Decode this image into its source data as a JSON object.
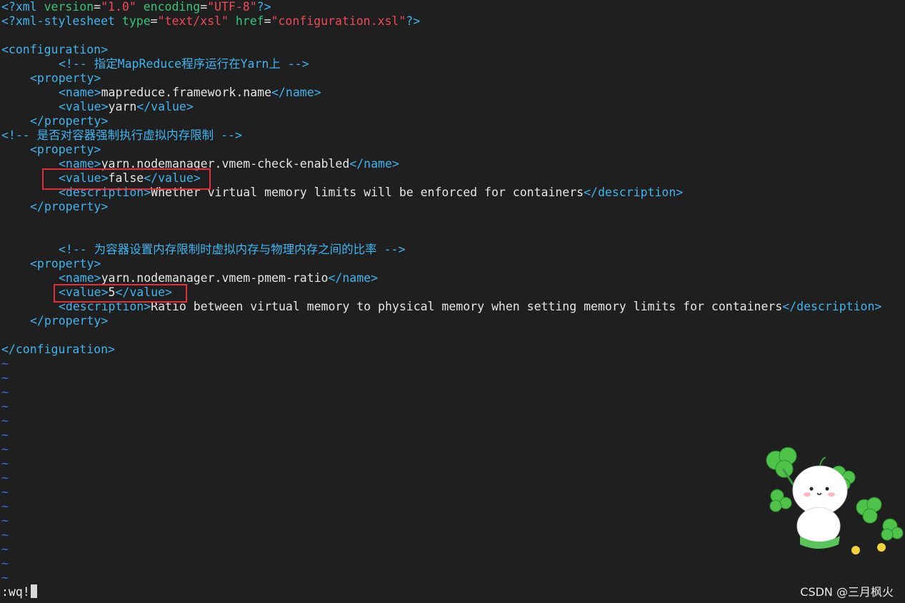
{
  "editor": {
    "xml_decl": {
      "open": "<?xml",
      "attr1": "version",
      "val1": "\"1.0\"",
      "attr2": "encoding",
      "val2": "\"UTF-8\"",
      "close": "?>"
    },
    "xsl_decl": {
      "open": "<?xml-stylesheet",
      "attr1": "type",
      "val1": "\"text/xsl\"",
      "attr2": "href",
      "val2": "\"configuration.xsl\"",
      "close": "?>"
    },
    "config_open": "<configuration>",
    "comment1": "<!-- 指定MapReduce程序运行在Yarn上 -->",
    "prop1": {
      "open": "<property>",
      "name_open": "<name>",
      "name": "mapreduce.framework.name",
      "name_close": "</name>",
      "value_open": "<value>",
      "value": "yarn",
      "value_close": "</value>",
      "close": "</property>"
    },
    "comment2": "<!-- 是否对容器强制执行虚拟内存限制 -->",
    "prop2": {
      "open": "<property>",
      "name_open": "<name>",
      "name": "yarn.nodemanager.vmem-check-enabled",
      "name_close": "</name>",
      "value_open": "<value>",
      "value": "false",
      "value_close": "</value>",
      "desc_open": "<description>",
      "desc": "Whether virtual memory limits will be enforced for containers",
      "desc_close": "</description>",
      "close": "</property>"
    },
    "comment3": "<!-- 为容器设置内存限制时虚拟内存与物理内存之间的比率 -->",
    "prop3": {
      "open": "<property>",
      "name_open": "<name>",
      "name": "yarn.nodemanager.vmem-pmem-ratio",
      "name_close": "</name>",
      "value_open": "<value>",
      "value": "5",
      "value_close": "</value>",
      "desc_open": "<description>",
      "desc": "Ratio between virtual memory to physical memory when setting memory limits for containers",
      "desc_close": "</description>",
      "close": "</property>"
    },
    "config_close": "</configuration>",
    "tilde": "~"
  },
  "command_line": ":wq!",
  "watermark": "CSDN @三月枫火",
  "colors": {
    "background": "#1f1f1f",
    "tag": "#3fb4ef",
    "attribute": "#36c47a",
    "string": "#f04a5a",
    "highlight_box": "#e0303a"
  }
}
